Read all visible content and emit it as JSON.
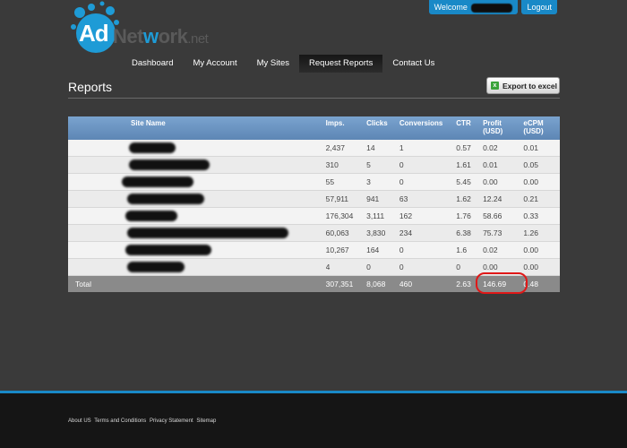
{
  "brand": {
    "ad": "Ad",
    "net_pre": "Net",
    "net_w": "w",
    "net_post": "ork",
    "tld": ".net"
  },
  "topbar": {
    "welcome": "Welcome",
    "logout": "Logout"
  },
  "nav": [
    "Dashboard",
    "My Account",
    "My Sites",
    "Request Reports",
    "Contact Us"
  ],
  "page": {
    "title": "Reports",
    "export": "Export to excel"
  },
  "table": {
    "headers": {
      "site": "Site Name",
      "imps": "Imps.",
      "clicks": "Clicks",
      "conv": "Conversions",
      "ctr": "CTR",
      "profit_1": "Profit",
      "profit_2": "(USD)",
      "ecpm_1": "eCPM",
      "ecpm_2": "(USD)"
    },
    "rows": [
      {
        "imps": "2,437",
        "clicks": "14",
        "conv": "1",
        "ctr": "0.57",
        "profit": "0.02",
        "ecpm": "0.01"
      },
      {
        "imps": "310",
        "clicks": "5",
        "conv": "0",
        "ctr": "1.61",
        "profit": "0.01",
        "ecpm": "0.05"
      },
      {
        "imps": "55",
        "clicks": "3",
        "conv": "0",
        "ctr": "5.45",
        "profit": "0.00",
        "ecpm": "0.00"
      },
      {
        "imps": "57,911",
        "clicks": "941",
        "conv": "63",
        "ctr": "1.62",
        "profit": "12.24",
        "ecpm": "0.21"
      },
      {
        "imps": "176,304",
        "clicks": "3,111",
        "conv": "162",
        "ctr": "1.76",
        "profit": "58.66",
        "ecpm": "0.33"
      },
      {
        "imps": "60,063",
        "clicks": "3,830",
        "conv": "234",
        "ctr": "6.38",
        "profit": "75.73",
        "ecpm": "1.26"
      },
      {
        "imps": "10,267",
        "clicks": "164",
        "conv": "0",
        "ctr": "1.6",
        "profit": "0.02",
        "ecpm": "0.00"
      },
      {
        "imps": "4",
        "clicks": "0",
        "conv": "0",
        "ctr": "0",
        "profit": "0.00",
        "ecpm": "0.00"
      }
    ],
    "total": {
      "label": "Total",
      "imps": "307,351",
      "clicks": "8,068",
      "conv": "460",
      "ctr": "2.63",
      "profit": "146.69",
      "ecpm": "0.48"
    }
  },
  "footer": {
    "links": [
      "About US",
      "Terms and Conditions",
      "Privacy Statement",
      "Sitemap"
    ]
  },
  "colors": {
    "accent": "#1989c7",
    "highlight": "#e01818"
  }
}
